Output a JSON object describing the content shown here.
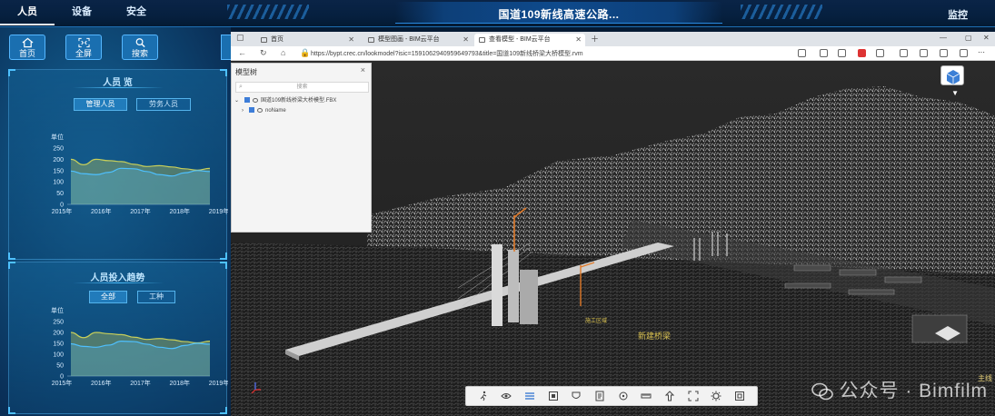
{
  "header": {
    "nav": [
      "人员",
      "设备",
      "安全"
    ],
    "active_nav": "人员",
    "title": "国道109新线高速公路...",
    "monitor": "监控"
  },
  "left_tools": [
    {
      "label": "首页",
      "icon": "home-icon"
    },
    {
      "label": "全屏",
      "icon": "fullscreen-icon"
    },
    {
      "label": "搜索",
      "icon": "search-icon"
    }
  ],
  "cards": [
    {
      "title": "人员  览",
      "buttons": [
        "管理人员",
        "劳务人员"
      ],
      "selected": 0,
      "chart_data": {
        "type": "area",
        "ylabel": "单位",
        "categories": [
          "2015年",
          "2016年",
          "2017年",
          "2018年",
          "2019年"
        ],
        "ylim": [
          0,
          250
        ],
        "yticks": [
          "250",
          "200",
          "150",
          "100",
          "50",
          "0"
        ],
        "series": [
          {
            "color": "#c8cf5a",
            "values": [
              200,
              176,
              200,
              194,
              190,
              178,
              168,
              172,
              166,
              158,
              152,
              160
            ]
          },
          {
            "color": "#4ec0ff",
            "values": [
              148,
              136,
              132,
              142,
              160,
              158,
              146,
              132,
              126,
              140,
              150,
              146
            ]
          }
        ]
      }
    },
    {
      "title": "人员投入趋势",
      "buttons": [
        "全部",
        "工种"
      ],
      "selected": 0,
      "chart_data": {
        "type": "area",
        "ylabel": "单位",
        "categories": [
          "2015年",
          "2016年",
          "2017年",
          "2018年",
          "2019年"
        ],
        "ylim": [
          0,
          250
        ],
        "yticks": [
          "250",
          "200",
          "150",
          "100",
          "50",
          "0"
        ],
        "series": [
          {
            "color": "#c8cf5a",
            "values": [
              200,
              176,
              200,
              194,
              190,
              178,
              168,
              172,
              166,
              158,
              152,
              160
            ]
          },
          {
            "color": "#4ec0ff",
            "values": [
              148,
              136,
              132,
              142,
              160,
              158,
              146,
              132,
              126,
              140,
              150,
              146
            ]
          }
        ]
      }
    }
  ],
  "browser": {
    "tabs": [
      "首页",
      "模型图画 - BIM云平台",
      "查看模型 - BIM云平台"
    ],
    "active_tab": 2,
    "url": "https://bypt.crec.cn/lookmodel?isic=1591062940959649793&title=国道109新线桥梁大桥模型.rvm",
    "tree": {
      "title": "模型树",
      "search_placeholder": "搜索",
      "rows": [
        "国道109新线桥梁大桥模型.FBX",
        "noName"
      ]
    }
  },
  "scene_labels": [
    "新建桥梁",
    "施工区域",
    "主线"
  ],
  "watermark": "公众号 · Bimfilm"
}
